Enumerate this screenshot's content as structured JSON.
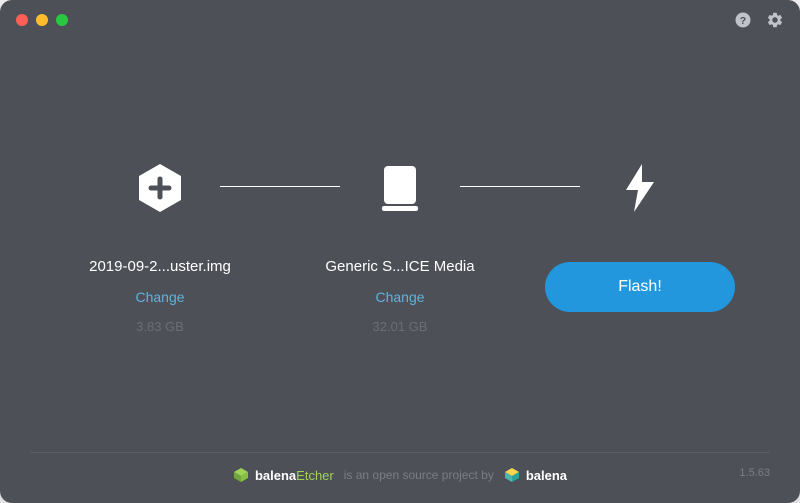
{
  "titlebar": {
    "help_icon": "help",
    "settings_icon": "settings"
  },
  "steps": {
    "image": {
      "name": "2019-09-2...uster.img",
      "change_label": "Change",
      "size": "3.83 GB"
    },
    "drive": {
      "name": "Generic S...ICE Media",
      "change_label": "Change",
      "size": "32.01 GB"
    },
    "flash": {
      "button_label": "Flash!"
    }
  },
  "footer": {
    "brand_prefix": "balena",
    "brand_suffix": "Etcher",
    "tagline": "is an open source project by",
    "company": "balena",
    "version": "1.5.63"
  },
  "colors": {
    "background": "#4d5057",
    "accent": "#2297de",
    "link": "#5fb3e0",
    "green": "#9fd356"
  }
}
